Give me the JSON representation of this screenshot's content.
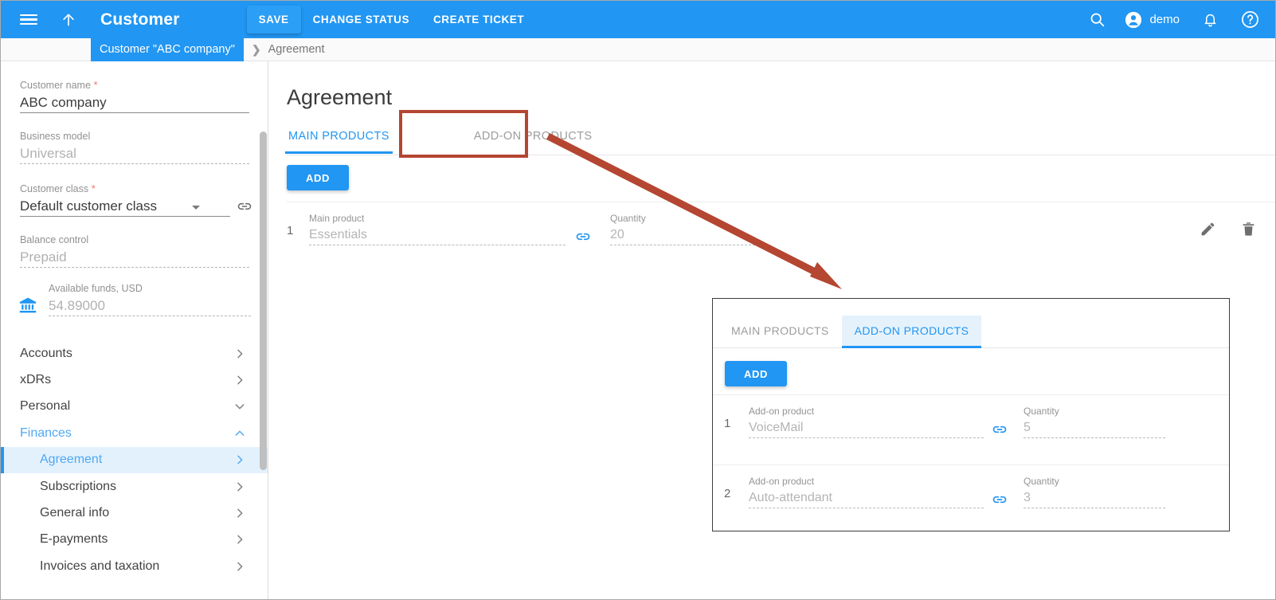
{
  "topbar": {
    "title": "Customer",
    "menu_icon": "hamburger-icon",
    "up_icon": "up-arrow-icon",
    "actions": [
      {
        "label": "SAVE",
        "active": true
      },
      {
        "label": "CHANGE STATUS",
        "active": false
      },
      {
        "label": "CREATE TICKET",
        "active": false
      }
    ],
    "search_icon": "search-icon",
    "account_icon": "account-circle-icon",
    "user": "demo",
    "bell_icon": "notifications-bell-icon",
    "help_icon": "help-circle-icon",
    "background": "#2196f3"
  },
  "breadcrumb": {
    "chip": "Customer \"ABC company\"",
    "separator": "❯",
    "current": "Agreement"
  },
  "sidebar": {
    "fields": [
      {
        "label": "Customer name",
        "required": true,
        "value": "ABC company",
        "readonly": false
      },
      {
        "label": "Business model",
        "required": false,
        "value": "Universal",
        "readonly": true
      },
      {
        "label": "Customer class",
        "required": true,
        "value": "Default customer class",
        "readonly": false
      },
      {
        "label": "Balance control",
        "required": false,
        "value": "Prepaid",
        "readonly": true
      }
    ],
    "funds": {
      "icon": "bank-icon",
      "label": "Available funds, USD",
      "value": "54.89000"
    },
    "nav": [
      {
        "label": "Accounts",
        "level": 1,
        "chevron": "chevron-right",
        "state": "normal"
      },
      {
        "label": "xDRs",
        "level": 1,
        "chevron": "chevron-right",
        "state": "normal"
      },
      {
        "label": "Personal",
        "level": 1,
        "chevron": "chevron-down",
        "state": "normal"
      },
      {
        "label": "Finances",
        "level": 1,
        "chevron": "chevron-up",
        "state": "open"
      },
      {
        "label": "Agreement",
        "level": 2,
        "chevron": "chevron-right",
        "state": "selected"
      },
      {
        "label": "Subscriptions",
        "level": 2,
        "chevron": "chevron-right",
        "state": "normal"
      },
      {
        "label": "General info",
        "level": 2,
        "chevron": "chevron-right",
        "state": "normal"
      },
      {
        "label": "E-payments",
        "level": 2,
        "chevron": "chevron-right",
        "state": "normal"
      },
      {
        "label": "Invoices and taxation",
        "level": 2,
        "chevron": "chevron-right",
        "state": "normal"
      }
    ]
  },
  "main": {
    "title": "Agreement",
    "tabs": [
      {
        "label": "MAIN PRODUCTS",
        "active": true
      },
      {
        "label": "ADD-ON PRODUCTS",
        "active": false
      }
    ],
    "add_label": "ADD",
    "row": {
      "index": "1",
      "product_label": "Main product",
      "product_value": "Essentials",
      "link_icon": "link-icon",
      "quantity_label": "Quantity",
      "quantity_value": "20",
      "edit_icon": "pencil-edit-icon",
      "delete_icon": "trash-delete-icon"
    }
  },
  "inset": {
    "tabs": [
      {
        "label": "MAIN PRODUCTS",
        "active": false
      },
      {
        "label": "ADD-ON PRODUCTS",
        "active": true
      }
    ],
    "add_label": "ADD",
    "rows": [
      {
        "index": "1",
        "product_label": "Add-on product",
        "product_value": "VoiceMail",
        "link_icon": "link-icon",
        "quantity_label": "Quantity",
        "quantity_value": "5"
      },
      {
        "index": "2",
        "product_label": "Add-on product",
        "product_value": "Auto-attendant",
        "link_icon": "link-icon",
        "quantity_label": "Quantity",
        "quantity_value": "3"
      }
    ]
  },
  "annotation": {
    "color": "#b44632",
    "highlight_target": "ADD-ON PRODUCTS",
    "arrow": "arrow-pointing-to-inset-panel"
  }
}
